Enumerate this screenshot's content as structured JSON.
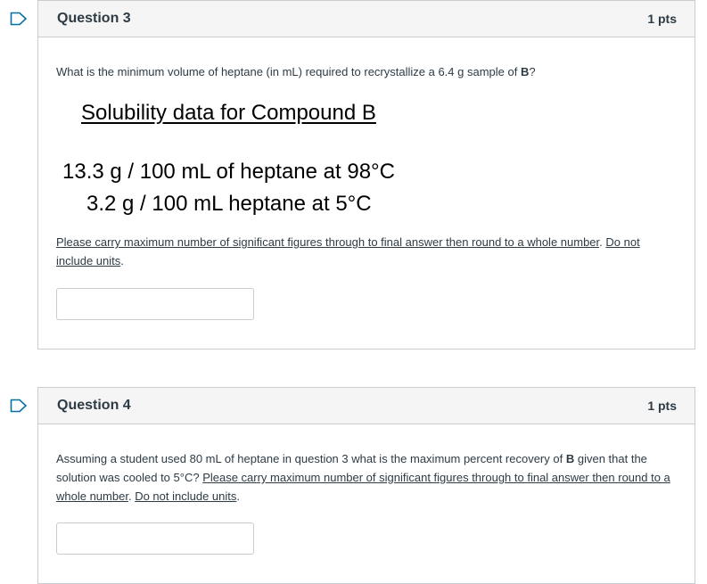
{
  "q3": {
    "title": "Question 3",
    "points": "1 pts",
    "prompt_a": "What is the minimum volume of heptane (in mL) required to recrystallize a 6.4 g sample of ",
    "prompt_bold": "B",
    "prompt_b": "?",
    "solubility_title": "Solubility data for Compound B",
    "solubility_line1": "13.3 g / 100 mL of heptane at 98°C",
    "solubility_line2": "3.2 g / 100 mL heptane at 5°C",
    "instruction_a": "Please carry maximum number of significant figures through to final answer then round to a whole number",
    "instruction_sep": ". ",
    "instruction_b": "Do not include units",
    "instruction_end": ".",
    "answer_value": ""
  },
  "q4": {
    "title": "Question 4",
    "points": "1 pts",
    "prompt_a": "Assuming a student used 80 mL of heptane in question 3 what is the maximum percent recovery of ",
    "prompt_bold": "B",
    "prompt_b": " given that the solution was cooled to 5°C? ",
    "instruction_a": "Please carry maximum number of significant figures through to final answer then round to a whole number",
    "instruction_sep": ". ",
    "instruction_b": "Do not include units",
    "instruction_end": ".",
    "answer_value": ""
  },
  "colors": {
    "flag": "#0770a3",
    "border": "#c7cdd1",
    "header_bg": "#f5f5f5",
    "text": "#2d3b45"
  },
  "icons": {
    "flag": "bookmark-flag-icon"
  }
}
